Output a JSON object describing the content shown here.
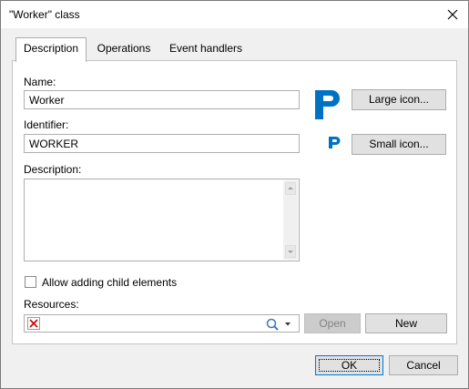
{
  "window": {
    "title": "\"Worker\" class"
  },
  "tabs": [
    {
      "label": "Description"
    },
    {
      "label": "Operations"
    },
    {
      "label": "Event handlers"
    }
  ],
  "form": {
    "name_label": "Name:",
    "name_value": "Worker",
    "identifier_label": "Identifier:",
    "identifier_value": "WORKER",
    "description_label": "Description:",
    "description_value": "",
    "allow_child_label": "Allow adding child elements",
    "allow_child_checked": false,
    "resources_label": "Resources:",
    "resources_value": ""
  },
  "icons": {
    "large": "p-logo-large-icon",
    "small": "p-logo-small-icon",
    "brand_color": "#0072c6"
  },
  "buttons": {
    "large_icon": "Large icon...",
    "small_icon": "Small icon...",
    "open": "Open",
    "new": "New",
    "ok": "OK",
    "cancel": "Cancel"
  }
}
